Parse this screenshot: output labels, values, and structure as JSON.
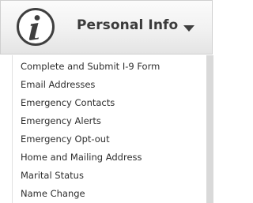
{
  "header": {
    "title": "Personal Info",
    "icon": "info-icon",
    "toggle_icon": "chevron-down-icon"
  },
  "menu": {
    "items": [
      {
        "label": "Complete and Submit I-9 Form"
      },
      {
        "label": "Email Addresses"
      },
      {
        "label": "Emergency Contacts"
      },
      {
        "label": "Emergency Alerts"
      },
      {
        "label": "Emergency Opt-out"
      },
      {
        "label": "Home and Mailing Address"
      },
      {
        "label": "Marital Status"
      },
      {
        "label": "Name Change"
      }
    ]
  },
  "colors": {
    "text": "#2e2e2e",
    "header_text": "#3b3b3b",
    "scroll_track": "#d9d9d9"
  }
}
